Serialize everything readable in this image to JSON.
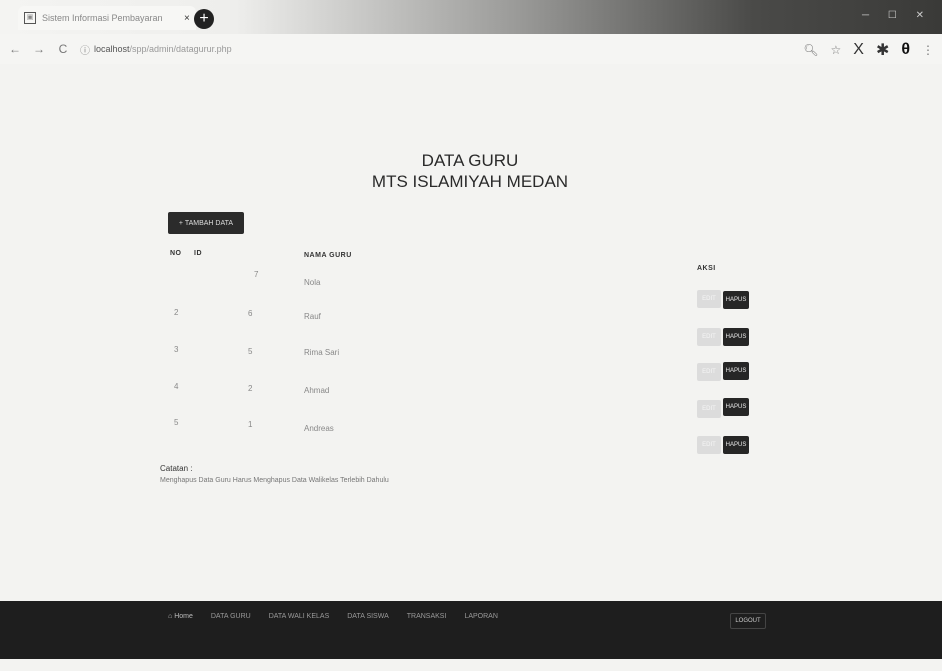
{
  "browser": {
    "tab_title": "Sistem Informasi Pembayaran",
    "tab_close": "×",
    "new_tab": "+",
    "url_host": "localhost",
    "url_path": "/spp/admin/datagurur.php"
  },
  "page": {
    "title_line1": "DATA GURU",
    "title_line2": "MTS ISLAMIYAH MEDAN",
    "add_button": "+ TAMBAH DATA"
  },
  "table": {
    "headers": {
      "no": "NO",
      "id": "ID",
      "name": "NAMA GURU",
      "action": "AKSI"
    },
    "rows": [
      {
        "no": "",
        "id": "7",
        "name": "Nola"
      },
      {
        "no": "2",
        "id": "6",
        "name": "Rauf"
      },
      {
        "no": "3",
        "id": "5",
        "name": "Rima Sari"
      },
      {
        "no": "4",
        "id": "2",
        "name": "Ahmad"
      },
      {
        "no": "5",
        "id": "1",
        "name": "Andreas"
      }
    ],
    "edit_label": "EDIT",
    "delete_label": "HAPUS"
  },
  "note": {
    "title": "Catatan :",
    "text": "Menghapus Data Guru Harus Menghapus Data Walikelas Terlebih Dahulu"
  },
  "footer": {
    "home": "Home",
    "items": [
      "DATA GURU",
      "DATA WALI KELAS",
      "DATA SISWA",
      "TRANSAKSI",
      "LAPORAN"
    ],
    "logout": "LOGOUT"
  }
}
